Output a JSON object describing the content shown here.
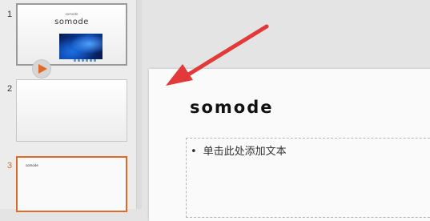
{
  "thumbnails": [
    {
      "number": "1",
      "tiny_label": "somode",
      "title": "somode"
    },
    {
      "number": "2"
    },
    {
      "number": "3",
      "tiny_label": "somode"
    }
  ],
  "slide": {
    "title": "somode",
    "bullet_text": "单击此处添加文本"
  },
  "colors": {
    "selected_accent": "#e0692a",
    "arrow": "#e23a3a"
  },
  "icons": {
    "play": "play-icon",
    "bullet": "bullet-icon",
    "arrow": "annotation-arrow"
  },
  "bullet_glyph": "•"
}
